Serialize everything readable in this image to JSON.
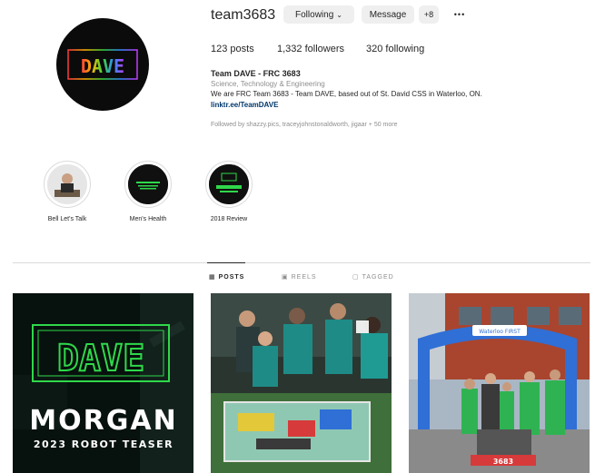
{
  "profile": {
    "username": "team3683",
    "following_button": "Following",
    "message_button": "Message",
    "add_user_icon": "+8",
    "more_icon": "•••",
    "posts": "123 posts",
    "followers": "1,332 followers",
    "following": "320 following",
    "name": "Team DAVE - FRC 3683",
    "category": "Science, Technology & Engineering",
    "bio": "We are FRC Team 3683 - Team DAVE, based out of St. David CSS in Waterloo, ON.",
    "link": "linktr.ee/TeamDAVE",
    "followed_by": "Followed by shazzy.pics, traceyjohnstonaldworth, jigaar + 50 more",
    "avatar_text": "DAVE"
  },
  "highlights": [
    {
      "label": "Bell Let's Talk"
    },
    {
      "label": "Men's Health"
    },
    {
      "label": "2018 Review"
    }
  ],
  "tabs": {
    "posts": "POSTS",
    "reels": "REELS",
    "tagged": "TAGGED"
  },
  "posts": [
    {
      "logo": "DAVE",
      "title": "MORGAN",
      "subtitle": "2023 ROBOT TEASER"
    },
    {
      "robot_number": ""
    },
    {
      "banner": "Waterloo FIRST",
      "robot_number": "3683"
    }
  ],
  "colors": {
    "accent_link": "#00376b",
    "button_bg": "#efefef",
    "brand_green": "#2fd84a"
  }
}
